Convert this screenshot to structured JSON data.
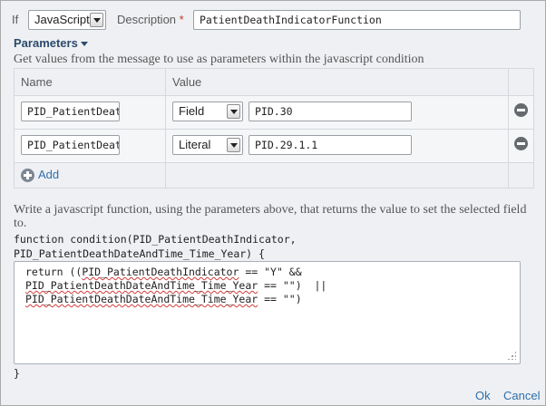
{
  "condition": {
    "if_label": "If",
    "language_value": "JavaScript",
    "description_label": "Description",
    "required_mark": "*",
    "description_value": "PatientDeathIndicatorFunction"
  },
  "parameters": {
    "title": "Parameters",
    "help": "Get values from the message to use as parameters within the javascript condition",
    "columns": {
      "name": "Name",
      "value": "Value"
    },
    "rows": [
      {
        "name": "PID_PatientDeat",
        "type": "Field",
        "value": "PID.30"
      },
      {
        "name": "PID_PatientDeat",
        "type": "Literal",
        "value": "PID.29.1.1"
      }
    ],
    "add_label": "Add"
  },
  "function": {
    "help": "Write a javascript function, using the parameters above, that returns the value to set the selected field to.",
    "signature_line1": "function condition(PID_PatientDeathIndicator,",
    "signature_line2": "PID_PatientDeathDateAndTime_Time_Year) {",
    "body": {
      "l1_pre": "return ((",
      "l1_var": "PID_PatientDeathIndicator",
      "l1_post": " == \"Y\" &&",
      "l2_var": "PID_PatientDeathDateAndTime_Time_Year",
      "l2_post": " == \"\")  ||",
      "l3_var": "PID_PatientDeathDateAndTime_Time_Year",
      "l3_post": " == \"\")"
    },
    "closing": "}"
  },
  "footer": {
    "ok_label": "Ok",
    "cancel_label": "Cancel"
  }
}
